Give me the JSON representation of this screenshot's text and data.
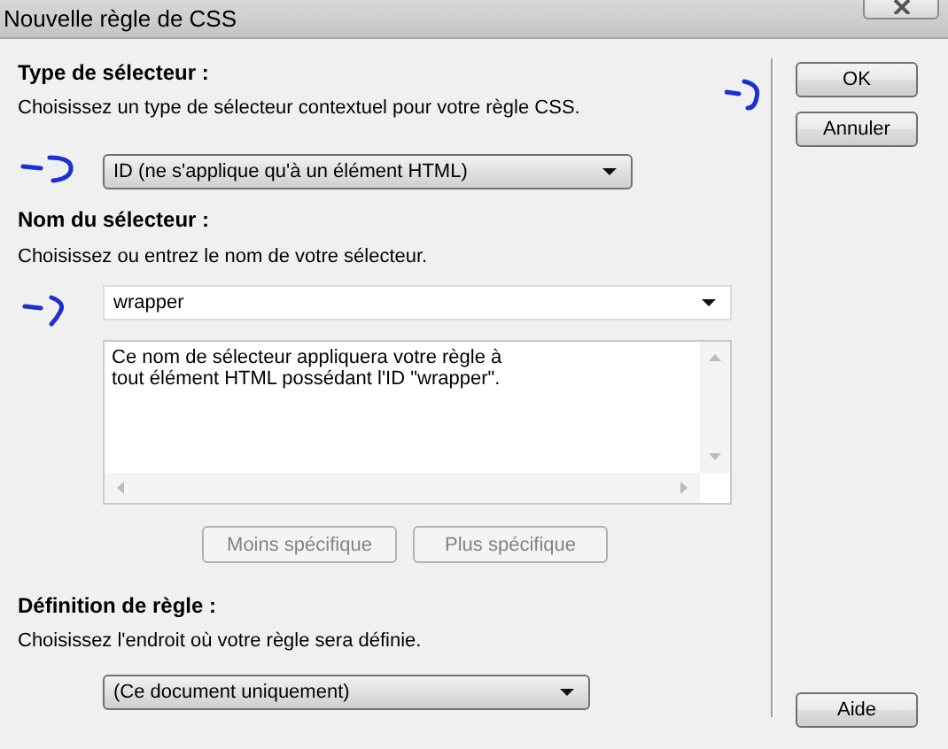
{
  "window": {
    "title": "Nouvelle règle de CSS"
  },
  "selector_type": {
    "label": "Type de sélecteur :",
    "description": "Choisissez un type de sélecteur contextuel pour votre règle CSS.",
    "value": "ID (ne s'applique qu'à un élément HTML)"
  },
  "selector_name": {
    "label": "Nom du sélecteur :",
    "description": "Choisissez ou entrez le nom de votre sélecteur.",
    "value": "wrapper",
    "info_text": "Ce nom de sélecteur appliquera votre règle à\ntout élément HTML possédant l'ID \"wrapper\".",
    "buttons": [
      {
        "label": "Moins spécifique",
        "disabled": true
      },
      {
        "label": "Plus spécifique",
        "disabled": true
      }
    ]
  },
  "rule_definition": {
    "label": "Définition de règle :",
    "description": "Choisissez l'endroit où votre règle sera définie.",
    "value": "(Ce document uniquement)"
  },
  "buttons": [
    {
      "label": "OK"
    },
    {
      "label": "Annuler"
    },
    {
      "label": "Aide"
    }
  ]
}
